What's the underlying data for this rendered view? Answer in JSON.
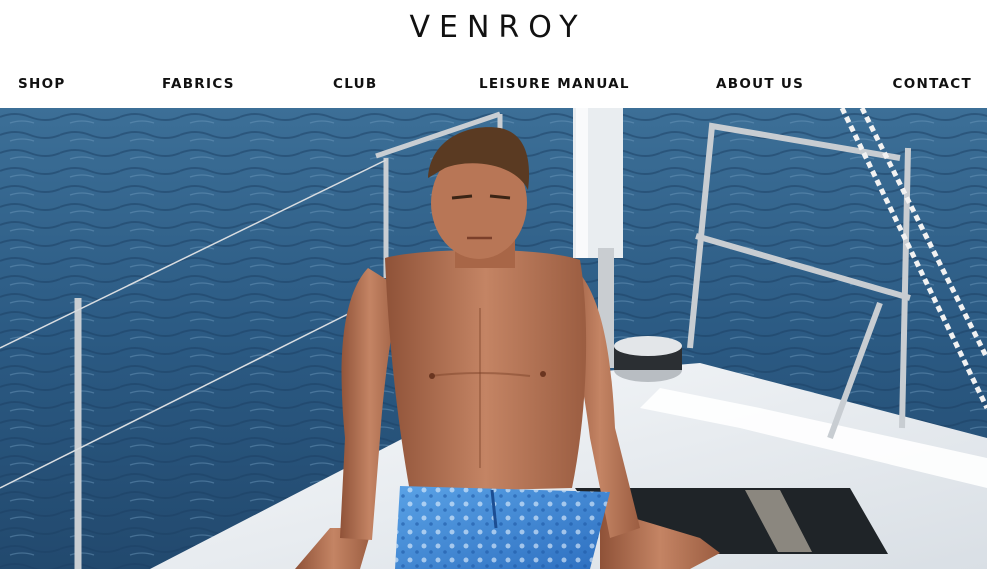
{
  "brand": {
    "logo_text": "VENROY"
  },
  "nav": {
    "items": [
      {
        "id": "shop",
        "label": "SHOP"
      },
      {
        "id": "fabrics",
        "label": "FABRICS"
      },
      {
        "id": "club",
        "label": "CLUB"
      },
      {
        "id": "leisure",
        "label": "LEISURE MANUAL"
      },
      {
        "id": "about",
        "label": "ABOUT US"
      },
      {
        "id": "contact",
        "label": "CONTACT"
      }
    ]
  },
  "hero": {
    "image_subject": "man-on-sailboat-bow",
    "colors": {
      "sea": "#2d5d86",
      "deck": "#eef1f4",
      "shorts": "#3d86d6",
      "skin": "#b9785a"
    }
  }
}
